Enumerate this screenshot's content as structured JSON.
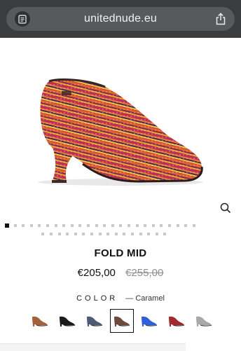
{
  "browser": {
    "url": "unitednude.eu",
    "icons": [
      "reader-mode-icon",
      "share-icon"
    ]
  },
  "product": {
    "name": "FOLD MID",
    "price_sale": "€205,00",
    "price_original": "€255,00",
    "image_icon": "ankle-boot-striped",
    "colors": {
      "stripe_primary": "#c8313e",
      "stripe_secondary": "#f0a030",
      "stripe_dark": "#4a2a4a"
    }
  },
  "gallery": {
    "active_index": 1,
    "row1_count": 24,
    "row2_count": 16
  },
  "color_selector": {
    "label": "COLOR",
    "selected_prefix": "—",
    "selected_value": "Caramel",
    "swatches": [
      {
        "name": "multi",
        "color": "#a0623a"
      },
      {
        "name": "black",
        "color": "#1b1b1b"
      },
      {
        "name": "blue-grey",
        "color": "#4e5a76"
      },
      {
        "name": "caramel",
        "color": "#6e4a3a",
        "selected": true
      },
      {
        "name": "blue",
        "color": "#2e5fd6"
      },
      {
        "name": "red",
        "color": "#a02a30"
      },
      {
        "name": "grey",
        "color": "#a8a8a8"
      }
    ]
  },
  "zoom_icon": "magnifier-icon"
}
